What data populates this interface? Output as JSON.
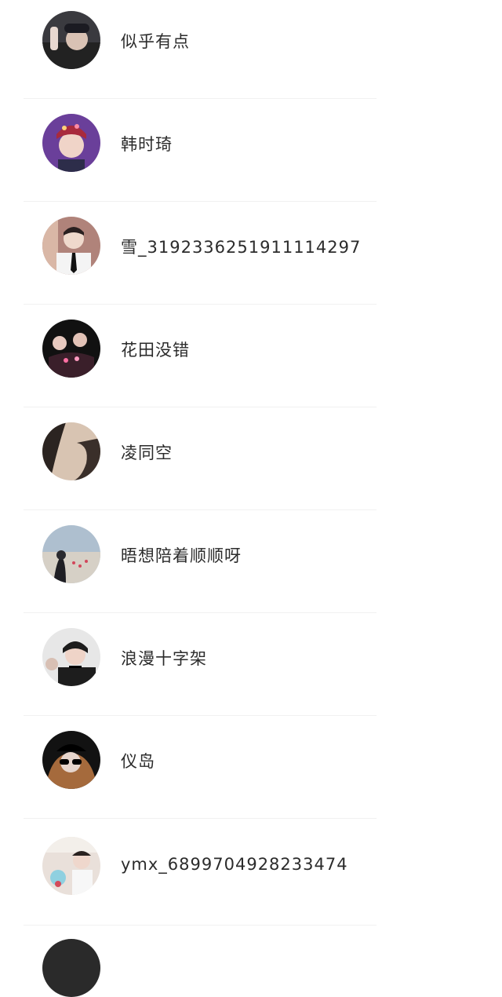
{
  "contacts": [
    {
      "name": "似乎有点",
      "avatar": "avatar-photo-person-cap"
    },
    {
      "name": "韩时琦",
      "avatar": "avatar-photo-person-flower-crown"
    },
    {
      "name": "雪_3192336251911114297",
      "avatar": "avatar-photo-person-tie"
    },
    {
      "name": "花田没错",
      "avatar": "avatar-photo-group-dark"
    },
    {
      "name": "凌同空",
      "avatar": "avatar-photo-shadow"
    },
    {
      "name": "晤想陪着顺顺呀",
      "avatar": "avatar-photo-beach-flowers"
    },
    {
      "name": "浪漫十字架",
      "avatar": "avatar-photo-person-choker"
    },
    {
      "name": "仪岛",
      "avatar": "avatar-photo-person-sunglasses"
    },
    {
      "name": "ymx_6899704928233474",
      "avatar": "avatar-photo-person-room"
    }
  ]
}
